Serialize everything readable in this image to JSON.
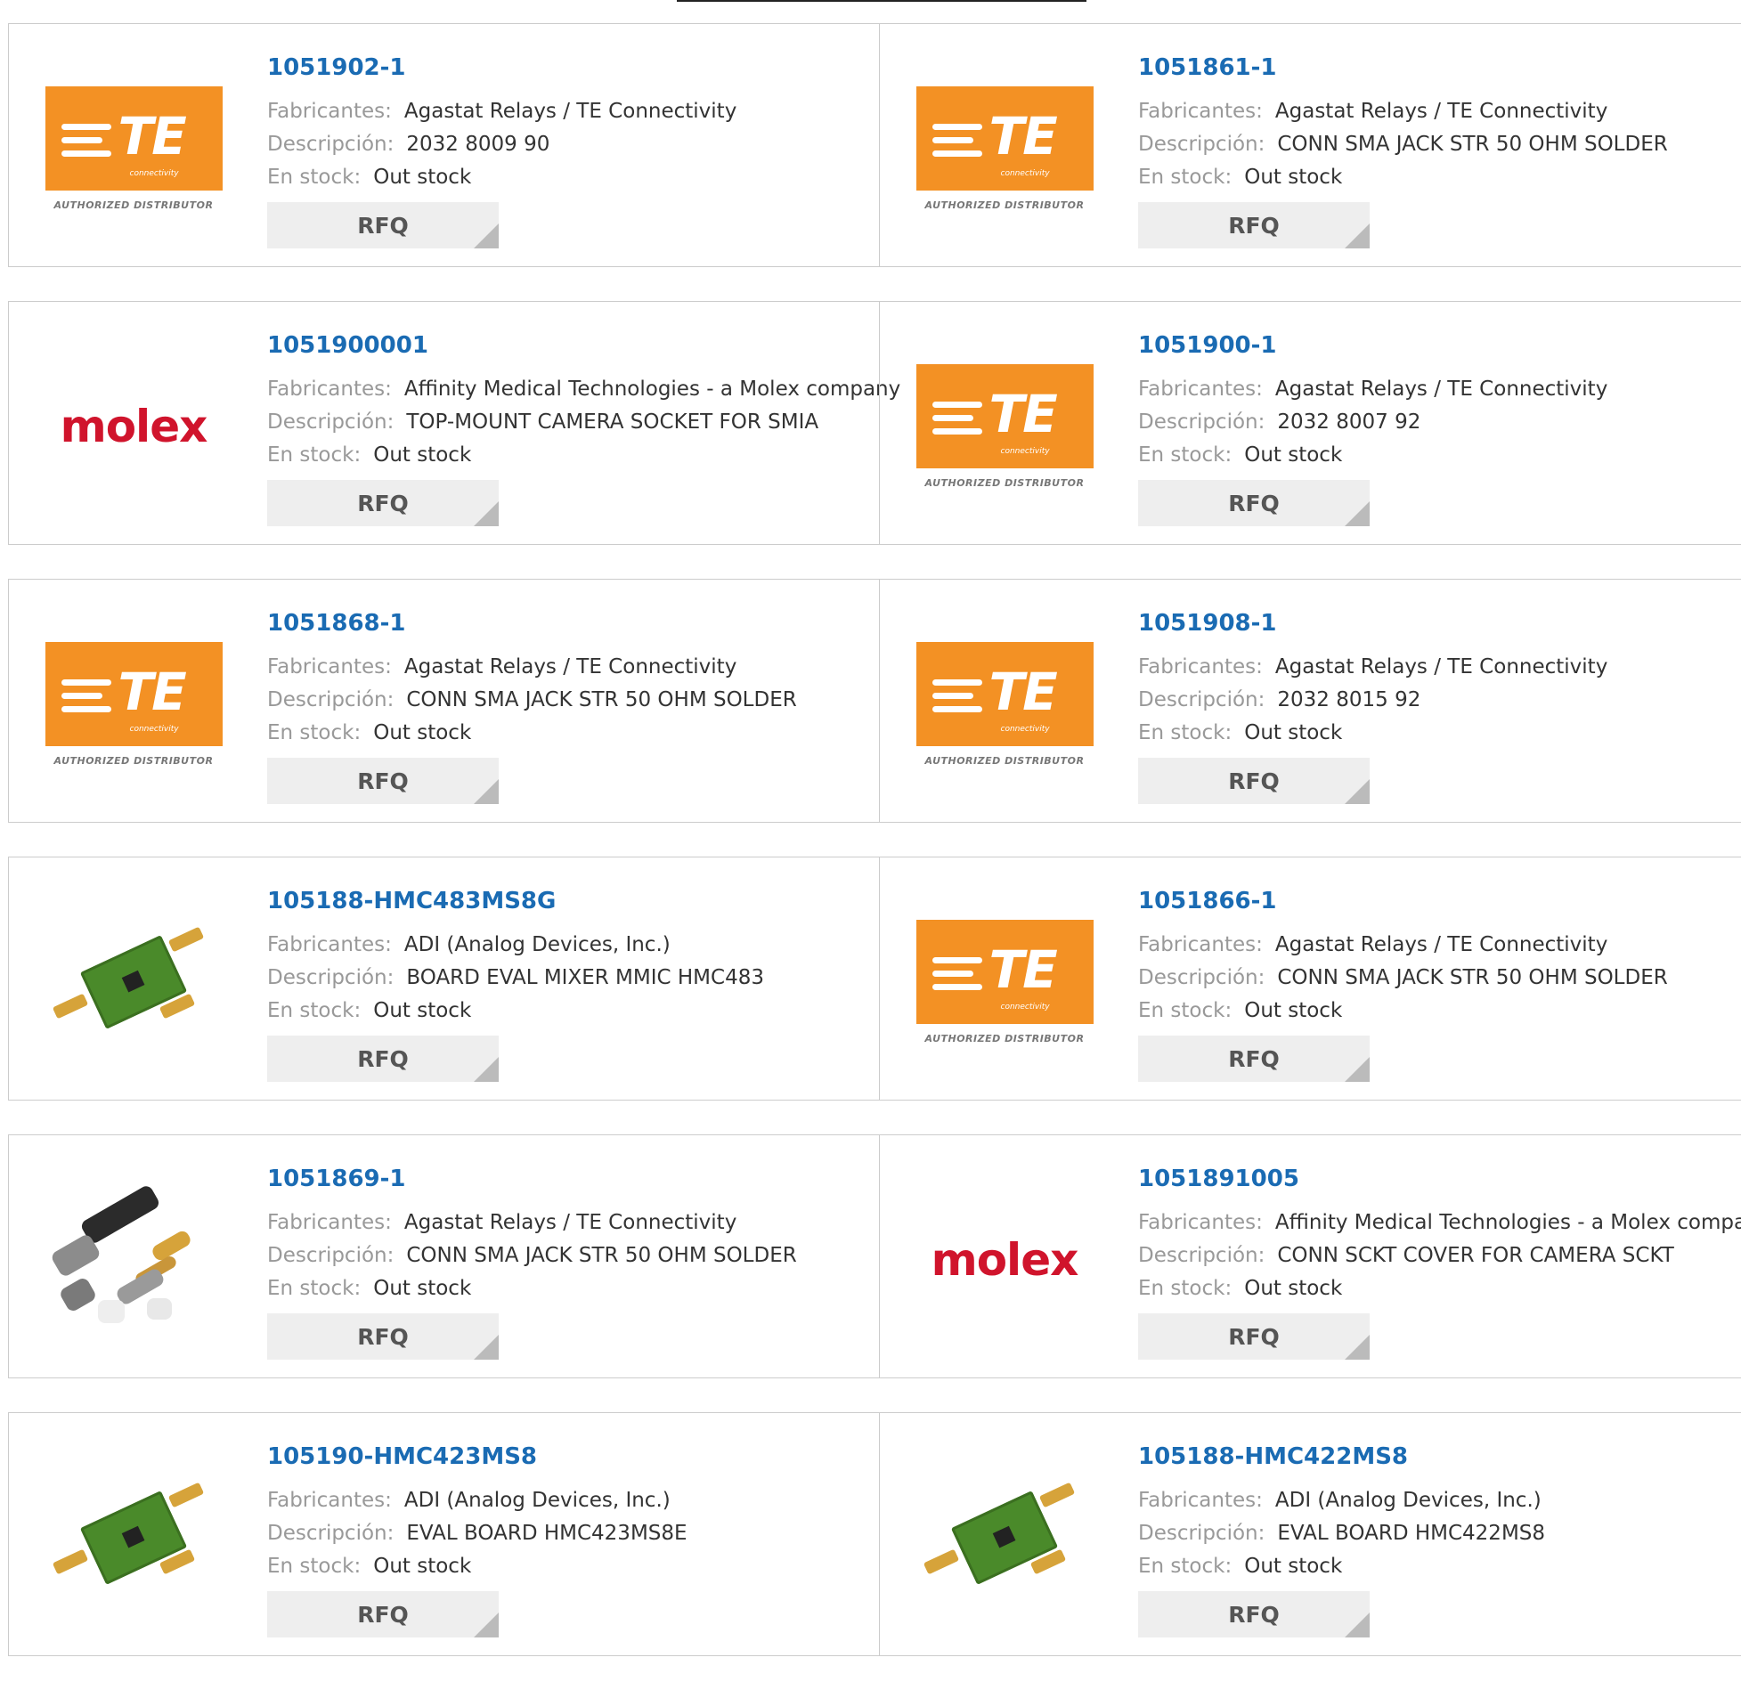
{
  "labels": {
    "manufacturer": "Fabricantes:",
    "description": "Descripción:",
    "stock": "En stock:",
    "rfq": "RFQ"
  },
  "logos": {
    "te_text": "TE",
    "te_sub": "connectivity",
    "te_dist": "AUTHORIZED DISTRIBUTOR",
    "molex_text": "molex"
  },
  "colors": {
    "part_link": "#1a6bb3",
    "te_orange": "#f39124",
    "molex_red": "#d0142c"
  },
  "products": [
    {
      "part": "1051902-1",
      "image": "te-logo",
      "manufacturer": "Agastat Relays / TE Connectivity",
      "description": "2032 8009 90",
      "stock": "Out stock"
    },
    {
      "part": "1051861-1",
      "image": "te-logo",
      "manufacturer": "Agastat Relays / TE Connectivity",
      "description": "CONN SMA JACK STR 50 OHM SOLDER",
      "stock": "Out stock"
    },
    {
      "part": "1051900001",
      "image": "molex-logo",
      "manufacturer": "Affinity Medical Technologies - a Molex company",
      "description": "TOP-MOUNT CAMERA SOCKET FOR SMIA",
      "stock": "Out stock"
    },
    {
      "part": "1051900-1",
      "image": "te-logo",
      "manufacturer": "Agastat Relays / TE Connectivity",
      "description": "2032 8007 92",
      "stock": "Out stock"
    },
    {
      "part": "1051868-1",
      "image": "te-logo",
      "manufacturer": "Agastat Relays / TE Connectivity",
      "description": "CONN SMA JACK STR 50 OHM SOLDER",
      "stock": "Out stock"
    },
    {
      "part": "1051908-1",
      "image": "te-logo",
      "manufacturer": "Agastat Relays / TE Connectivity",
      "description": "2032 8015 92",
      "stock": "Out stock"
    },
    {
      "part": "105188-HMC483MS8G",
      "image": "eval-board-photo",
      "manufacturer": "ADI (Analog Devices, Inc.)",
      "description": "BOARD EVAL MIXER MMIC HMC483",
      "stock": "Out stock"
    },
    {
      "part": "1051866-1",
      "image": "te-logo",
      "manufacturer": "Agastat Relays / TE Connectivity",
      "description": "CONN SMA JACK STR 50 OHM SOLDER",
      "stock": "Out stock"
    },
    {
      "part": "1051869-1",
      "image": "connector-kit-photo",
      "manufacturer": "Agastat Relays / TE Connectivity",
      "description": "CONN SMA JACK STR 50 OHM SOLDER",
      "stock": "Out stock"
    },
    {
      "part": "1051891005",
      "image": "molex-logo",
      "manufacturer": "Affinity Medical Technologies - a Molex company",
      "description": "CONN SCKT COVER FOR CAMERA SCKT",
      "stock": "Out stock"
    },
    {
      "part": "105190-HMC423MS8",
      "image": "eval-board-photo",
      "manufacturer": "ADI (Analog Devices, Inc.)",
      "description": "EVAL BOARD HMC423MS8E",
      "stock": "Out stock"
    },
    {
      "part": "105188-HMC422MS8",
      "image": "eval-board-photo",
      "manufacturer": "ADI (Analog Devices, Inc.)",
      "description": "EVAL BOARD HMC422MS8",
      "stock": "Out stock"
    }
  ]
}
